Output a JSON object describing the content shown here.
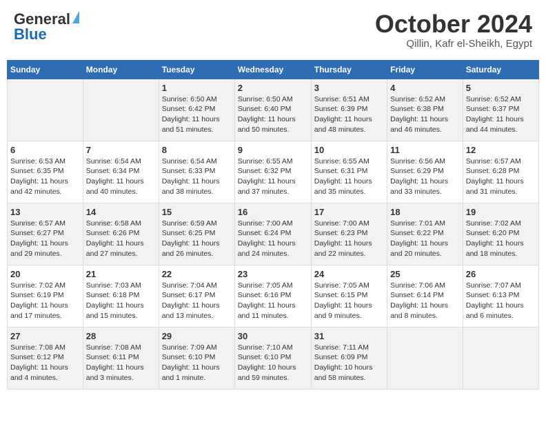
{
  "logo": {
    "text1": "General",
    "text2": "Blue"
  },
  "title": "October 2024",
  "location": "Qillin, Kafr el-Sheikh, Egypt",
  "days_of_week": [
    "Sunday",
    "Monday",
    "Tuesday",
    "Wednesday",
    "Thursday",
    "Friday",
    "Saturday"
  ],
  "weeks": [
    [
      {
        "day": "",
        "sunrise": "",
        "sunset": "",
        "daylight": ""
      },
      {
        "day": "",
        "sunrise": "",
        "sunset": "",
        "daylight": ""
      },
      {
        "day": "1",
        "sunrise": "Sunrise: 6:50 AM",
        "sunset": "Sunset: 6:42 PM",
        "daylight": "Daylight: 11 hours and 51 minutes."
      },
      {
        "day": "2",
        "sunrise": "Sunrise: 6:50 AM",
        "sunset": "Sunset: 6:40 PM",
        "daylight": "Daylight: 11 hours and 50 minutes."
      },
      {
        "day": "3",
        "sunrise": "Sunrise: 6:51 AM",
        "sunset": "Sunset: 6:39 PM",
        "daylight": "Daylight: 11 hours and 48 minutes."
      },
      {
        "day": "4",
        "sunrise": "Sunrise: 6:52 AM",
        "sunset": "Sunset: 6:38 PM",
        "daylight": "Daylight: 11 hours and 46 minutes."
      },
      {
        "day": "5",
        "sunrise": "Sunrise: 6:52 AM",
        "sunset": "Sunset: 6:37 PM",
        "daylight": "Daylight: 11 hours and 44 minutes."
      }
    ],
    [
      {
        "day": "6",
        "sunrise": "Sunrise: 6:53 AM",
        "sunset": "Sunset: 6:35 PM",
        "daylight": "Daylight: 11 hours and 42 minutes."
      },
      {
        "day": "7",
        "sunrise": "Sunrise: 6:54 AM",
        "sunset": "Sunset: 6:34 PM",
        "daylight": "Daylight: 11 hours and 40 minutes."
      },
      {
        "day": "8",
        "sunrise": "Sunrise: 6:54 AM",
        "sunset": "Sunset: 6:33 PM",
        "daylight": "Daylight: 11 hours and 38 minutes."
      },
      {
        "day": "9",
        "sunrise": "Sunrise: 6:55 AM",
        "sunset": "Sunset: 6:32 PM",
        "daylight": "Daylight: 11 hours and 37 minutes."
      },
      {
        "day": "10",
        "sunrise": "Sunrise: 6:55 AM",
        "sunset": "Sunset: 6:31 PM",
        "daylight": "Daylight: 11 hours and 35 minutes."
      },
      {
        "day": "11",
        "sunrise": "Sunrise: 6:56 AM",
        "sunset": "Sunset: 6:29 PM",
        "daylight": "Daylight: 11 hours and 33 minutes."
      },
      {
        "day": "12",
        "sunrise": "Sunrise: 6:57 AM",
        "sunset": "Sunset: 6:28 PM",
        "daylight": "Daylight: 11 hours and 31 minutes."
      }
    ],
    [
      {
        "day": "13",
        "sunrise": "Sunrise: 6:57 AM",
        "sunset": "Sunset: 6:27 PM",
        "daylight": "Daylight: 11 hours and 29 minutes."
      },
      {
        "day": "14",
        "sunrise": "Sunrise: 6:58 AM",
        "sunset": "Sunset: 6:26 PM",
        "daylight": "Daylight: 11 hours and 27 minutes."
      },
      {
        "day": "15",
        "sunrise": "Sunrise: 6:59 AM",
        "sunset": "Sunset: 6:25 PM",
        "daylight": "Daylight: 11 hours and 26 minutes."
      },
      {
        "day": "16",
        "sunrise": "Sunrise: 7:00 AM",
        "sunset": "Sunset: 6:24 PM",
        "daylight": "Daylight: 11 hours and 24 minutes."
      },
      {
        "day": "17",
        "sunrise": "Sunrise: 7:00 AM",
        "sunset": "Sunset: 6:23 PM",
        "daylight": "Daylight: 11 hours and 22 minutes."
      },
      {
        "day": "18",
        "sunrise": "Sunrise: 7:01 AM",
        "sunset": "Sunset: 6:22 PM",
        "daylight": "Daylight: 11 hours and 20 minutes."
      },
      {
        "day": "19",
        "sunrise": "Sunrise: 7:02 AM",
        "sunset": "Sunset: 6:20 PM",
        "daylight": "Daylight: 11 hours and 18 minutes."
      }
    ],
    [
      {
        "day": "20",
        "sunrise": "Sunrise: 7:02 AM",
        "sunset": "Sunset: 6:19 PM",
        "daylight": "Daylight: 11 hours and 17 minutes."
      },
      {
        "day": "21",
        "sunrise": "Sunrise: 7:03 AM",
        "sunset": "Sunset: 6:18 PM",
        "daylight": "Daylight: 11 hours and 15 minutes."
      },
      {
        "day": "22",
        "sunrise": "Sunrise: 7:04 AM",
        "sunset": "Sunset: 6:17 PM",
        "daylight": "Daylight: 11 hours and 13 minutes."
      },
      {
        "day": "23",
        "sunrise": "Sunrise: 7:05 AM",
        "sunset": "Sunset: 6:16 PM",
        "daylight": "Daylight: 11 hours and 11 minutes."
      },
      {
        "day": "24",
        "sunrise": "Sunrise: 7:05 AM",
        "sunset": "Sunset: 6:15 PM",
        "daylight": "Daylight: 11 hours and 9 minutes."
      },
      {
        "day": "25",
        "sunrise": "Sunrise: 7:06 AM",
        "sunset": "Sunset: 6:14 PM",
        "daylight": "Daylight: 11 hours and 8 minutes."
      },
      {
        "day": "26",
        "sunrise": "Sunrise: 7:07 AM",
        "sunset": "Sunset: 6:13 PM",
        "daylight": "Daylight: 11 hours and 6 minutes."
      }
    ],
    [
      {
        "day": "27",
        "sunrise": "Sunrise: 7:08 AM",
        "sunset": "Sunset: 6:12 PM",
        "daylight": "Daylight: 11 hours and 4 minutes."
      },
      {
        "day": "28",
        "sunrise": "Sunrise: 7:08 AM",
        "sunset": "Sunset: 6:11 PM",
        "daylight": "Daylight: 11 hours and 3 minutes."
      },
      {
        "day": "29",
        "sunrise": "Sunrise: 7:09 AM",
        "sunset": "Sunset: 6:10 PM",
        "daylight": "Daylight: 11 hours and 1 minute."
      },
      {
        "day": "30",
        "sunrise": "Sunrise: 7:10 AM",
        "sunset": "Sunset: 6:10 PM",
        "daylight": "Daylight: 10 hours and 59 minutes."
      },
      {
        "day": "31",
        "sunrise": "Sunrise: 7:11 AM",
        "sunset": "Sunset: 6:09 PM",
        "daylight": "Daylight: 10 hours and 58 minutes."
      },
      {
        "day": "",
        "sunrise": "",
        "sunset": "",
        "daylight": ""
      },
      {
        "day": "",
        "sunrise": "",
        "sunset": "",
        "daylight": ""
      }
    ]
  ]
}
